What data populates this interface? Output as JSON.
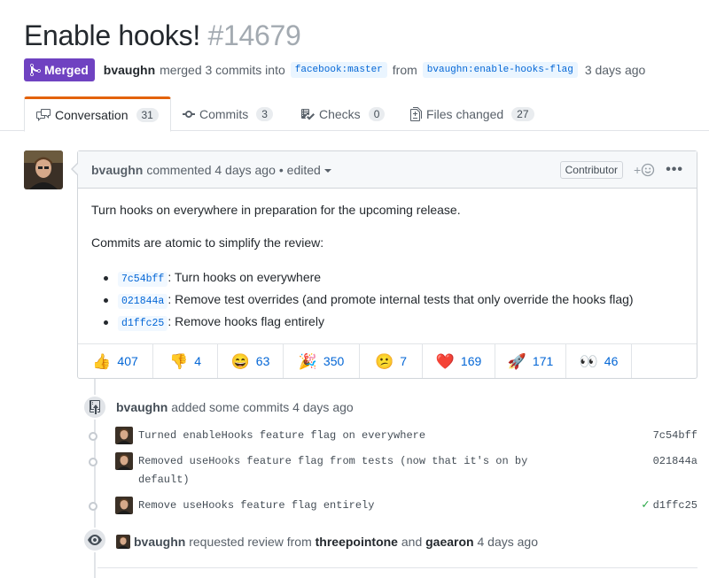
{
  "pr": {
    "title": "Enable hooks!",
    "number": "#14679",
    "state": "Merged",
    "author": "bvaughn",
    "merge_text": "merged 3 commits into",
    "base_branch": "facebook:master",
    "from_text": "from",
    "head_branch": "bvaughn:enable-hooks-flag",
    "ago": "3 days ago"
  },
  "tabs": [
    {
      "label": "Conversation",
      "count": "31",
      "icon": "comment-discussion-icon"
    },
    {
      "label": "Commits",
      "count": "3",
      "icon": "git-commit-icon"
    },
    {
      "label": "Checks",
      "count": "0",
      "icon": "checklist-icon"
    },
    {
      "label": "Files changed",
      "count": "27",
      "icon": "file-diff-icon"
    }
  ],
  "comment": {
    "author": "bvaughn",
    "header_text": "commented 4 days ago",
    "edited": "• edited",
    "role": "Contributor",
    "add_reaction": "+",
    "more": "•••",
    "body_p1": "Turn hooks on everywhere in preparation for the upcoming release.",
    "body_p2": "Commits are atomic to simplify the review:",
    "list": [
      {
        "sha": "7c54bff",
        "text": ": Turn hooks on everywhere"
      },
      {
        "sha": "021844a",
        "text": ": Remove test overrides (and promote internal tests that only override the hooks flag)"
      },
      {
        "sha": "d1ffc25",
        "text": ": Remove hooks flag entirely"
      }
    ],
    "reactions": [
      {
        "emoji": "👍",
        "count": "407"
      },
      {
        "emoji": "👎",
        "count": "4"
      },
      {
        "emoji": "😄",
        "count": "63"
      },
      {
        "emoji": "🎉",
        "count": "350"
      },
      {
        "emoji": "😕",
        "count": "7"
      },
      {
        "emoji": "❤️",
        "count": "169"
      },
      {
        "emoji": "🚀",
        "count": "171"
      },
      {
        "emoji": "👀",
        "count": "46"
      }
    ]
  },
  "timeline": {
    "commits_event": {
      "author": "bvaughn",
      "text": "added some commits 4 days ago"
    },
    "commits": [
      {
        "message": "Turned enableHooks feature flag on everywhere",
        "sha": "7c54bff"
      },
      {
        "message": "Removed useHooks feature flag from tests (now that it's on by default)",
        "sha": "021844a"
      },
      {
        "message": "Remove useHooks feature flag entirely",
        "sha": "d1ffc25",
        "check": "✓"
      }
    ],
    "review_event": {
      "author": "bvaughn",
      "text1": "requested review from",
      "reviewer1": "threepointone",
      "and": "and",
      "reviewer2": "gaearon",
      "ago": "4 days ago"
    }
  },
  "colors": {
    "merged": "#6f42c1",
    "link": "#0366d6",
    "tab_accent": "#e36209",
    "check": "#28a745"
  }
}
